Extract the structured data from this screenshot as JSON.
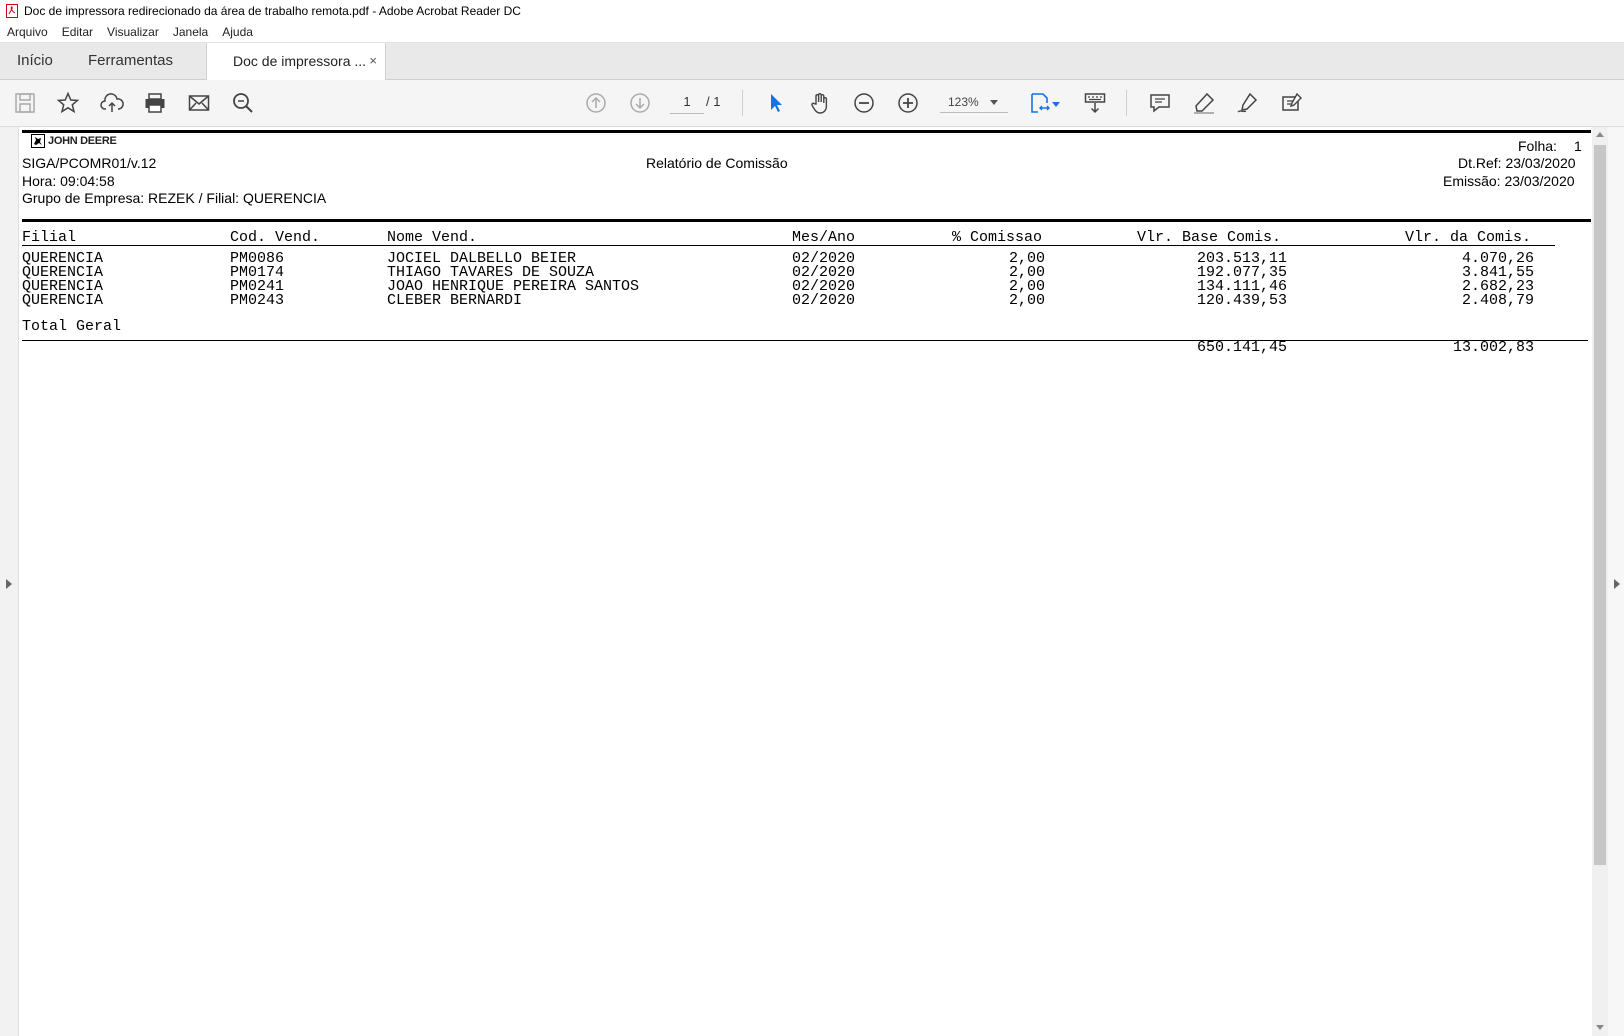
{
  "window": {
    "title": "Doc de impressora redirecionado da área de trabalho remota.pdf - Adobe Acrobat Reader DC"
  },
  "menu": [
    "Arquivo",
    "Editar",
    "Visualizar",
    "Janela",
    "Ajuda"
  ],
  "tabs": {
    "home": "Início",
    "tools": "Ferramentas",
    "document": "Doc de impressora ...",
    "close": "×"
  },
  "toolbar": {
    "page_current": "1",
    "page_total": "/ 1",
    "zoom": "123%"
  },
  "report": {
    "logo_text": "JOHN DEERE",
    "folha_label": "Folha:",
    "folha_value": "1",
    "program": "SIGA/PCOMR01/v.12",
    "title": "Relatório de Comissão",
    "dtref": "Dt.Ref: 23/03/2020",
    "hora": "Hora: 09:04:58",
    "emissao": "Emissão: 23/03/2020",
    "grupo": "Grupo de Empresa: REZEK / Filial: QUERENCIA",
    "columns": [
      "Filial",
      "Cod. Vend.",
      "Nome Vend.",
      "Mes/Ano",
      "% Comissao",
      "Vlr. Base Comis.",
      "Vlr. da Comis."
    ],
    "rows": [
      [
        "QUERENCIA",
        "PM0086",
        "JOCIEL DALBELLO BEIER",
        "02/2020",
        "2,00",
        "203.513,11",
        "4.070,26"
      ],
      [
        "QUERENCIA",
        "PM0174",
        "THIAGO TAVARES DE SOUZA",
        "02/2020",
        "2,00",
        "192.077,35",
        "3.841,55"
      ],
      [
        "QUERENCIA",
        "PM0241",
        "JOAO HENRIQUE PEREIRA SANTOS",
        "02/2020",
        "2,00",
        "134.111,46",
        "2.682,23"
      ],
      [
        "QUERENCIA",
        "PM0243",
        "CLEBER BERNARDI",
        "02/2020",
        "2,00",
        "120.439,53",
        "2.408,79"
      ]
    ],
    "total_label": "Total Geral",
    "total_base": "650.141,45",
    "total_comis": "13.002,83"
  }
}
